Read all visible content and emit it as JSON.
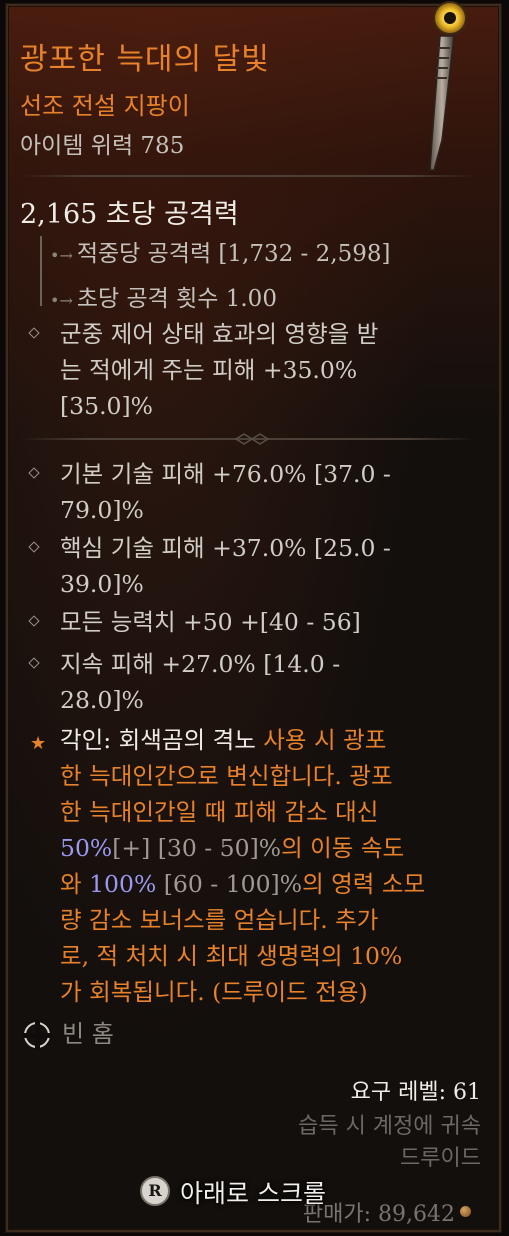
{
  "item": {
    "name": "광포한 늑대의 달빛",
    "type": "선조 전설 지팡이",
    "power": "아이템 위력 785"
  },
  "stats": {
    "dps": "2,165 초당 공격력",
    "damage_per_hit": "적중당 공격력 [1,732 - 2,598]",
    "attacks_per_second": "초당 공격 횟수 1.00"
  },
  "implicit": {
    "line1": "군중 제어 상태 효과의 영향을 받",
    "line2": "는 적에게 주는 피해 +35.0%",
    "line3": "[35.0]%"
  },
  "affixes": [
    {
      "line1": "기본 기술 피해 +76.0% [37.0 -",
      "line2": "79.0]%"
    },
    {
      "line1": "핵심 기술 피해 +37.0% [25.0 -",
      "line2": "39.0]%"
    },
    {
      "line1": "모든 능력치 +50 +[40 - 56]",
      "line2": ""
    },
    {
      "line1": "지속 피해 +27.0% [14.0 -",
      "line2": "28.0]%"
    }
  ],
  "aspect": {
    "prefix": "각인: 회색곰의 격노",
    "text1": " 사용 시 광포",
    "text2": "한 늑대인간으로 변신합니다. 광포",
    "text3": "한 늑대인간일 때 피해 감소 대신",
    "value1": "50%",
    "range1_plus": "[+]",
    "range1": " [30 - 50]%",
    "text4": "의 이동 속도",
    "text5": "와 ",
    "value2": "100%",
    "range2": " [60 - 100]%",
    "text6": "의 영력 소모",
    "text7": "량 감소 보너스를 얻습니다. 추가",
    "text8": "로, 적 처치 시 최대 생명력의 10%",
    "text9": "가 회복됩니다. (드루이드 전용)"
  },
  "socket": {
    "label": "빈 홈"
  },
  "requirements": {
    "level": "요구 레벨: 61",
    "bind": "습득 시 계정에 귀속",
    "class": "드루이드"
  },
  "sell": {
    "value": "판매가: 89,642"
  },
  "scroll": {
    "button_glyph": "R",
    "label": "아래로 스크롤"
  },
  "colors": {
    "legendary_orange": "#e8822a",
    "value_blue": "#9a98f0",
    "text_main": "#d0ccc6"
  }
}
